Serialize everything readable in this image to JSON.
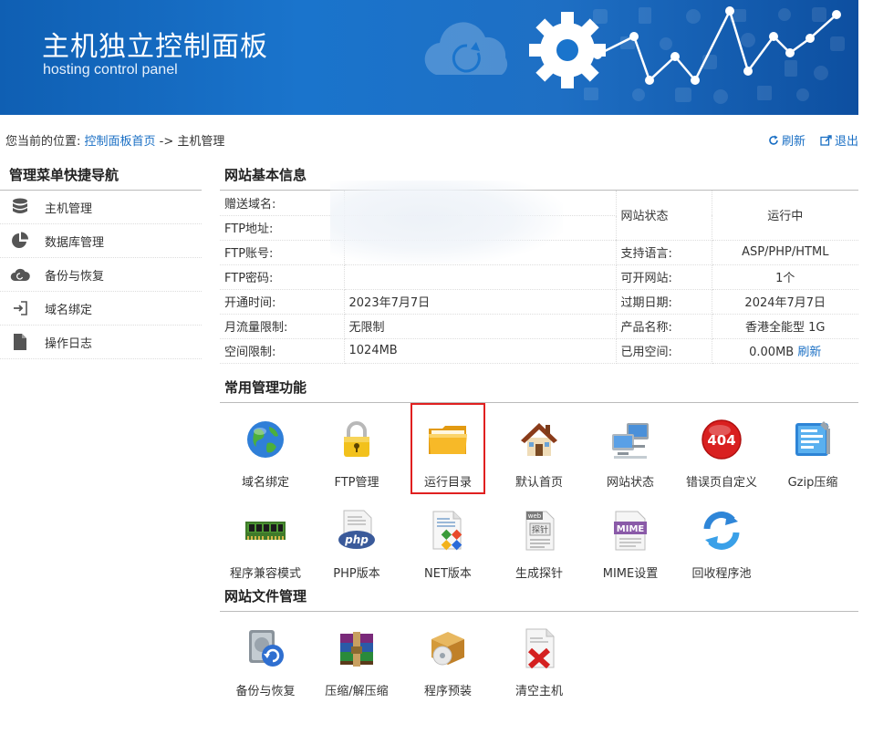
{
  "banner": {
    "title": "主机独立控制面板",
    "subtitle": "hosting control panel"
  },
  "location": {
    "prefix": "您当前的位置:",
    "home_link": "控制面板首页",
    "separator": " -> ",
    "current": "主机管理",
    "refresh_label": "刷新",
    "logout_label": "退出"
  },
  "sidebar": {
    "title": "管理菜单快捷导航",
    "items": [
      {
        "label": "主机管理",
        "icon": "database-icon"
      },
      {
        "label": "数据库管理",
        "icon": "pie-chart-icon"
      },
      {
        "label": "备份与恢复",
        "icon": "cloud-icon"
      },
      {
        "label": "域名绑定",
        "icon": "login-arrow-icon"
      },
      {
        "label": "操作日志",
        "icon": "document-icon"
      }
    ]
  },
  "site_info": {
    "title": "网站基本信息",
    "rows": [
      {
        "k": "赠送域名:",
        "v": "",
        "k2": "网站状态",
        "v2": "运行中"
      },
      {
        "k": "FTP地址:",
        "v": ""
      },
      {
        "k": "FTP账号:",
        "v": "",
        "k2": "支持语言:",
        "v2": "ASP/PHP/HTML"
      },
      {
        "k": "FTP密码:",
        "v": "",
        "k2": "可开网站:",
        "v2": "1个"
      },
      {
        "k": "开通时间:",
        "v": "2023年7月7日",
        "k2": "过期日期:",
        "v2": "2024年7月7日"
      },
      {
        "k": "月流量限制:",
        "v": "无限制",
        "k2": "产品名称:",
        "v2": "香港全能型 1G"
      },
      {
        "k": "空间限制:",
        "v": "1024MB",
        "k2": "已用空间:",
        "v2": "0.00MB",
        "v2_link": "刷新"
      }
    ],
    "status_color": "#2e9a2e"
  },
  "common": {
    "title": "常用管理功能",
    "tiles": [
      {
        "label": "域名绑定",
        "icon": "globe-icon"
      },
      {
        "label": "FTP管理",
        "icon": "padlock-icon"
      },
      {
        "label": "运行目录",
        "icon": "folder-icon",
        "highlighted": true
      },
      {
        "label": "默认首页",
        "icon": "house-icon"
      },
      {
        "label": "网站状态",
        "icon": "computers-icon"
      },
      {
        "label": "错误页自定义",
        "icon": "error-404-icon",
        "badge": "404"
      },
      {
        "label": "Gzip压缩",
        "icon": "archive-tool-icon"
      },
      {
        "label": "程序兼容模式",
        "icon": "memory-chip-icon"
      },
      {
        "label": "PHP版本",
        "icon": "php-icon",
        "badge": "php"
      },
      {
        "label": "NET版本",
        "icon": "net-document-icon"
      },
      {
        "label": "生成探针",
        "icon": "probe-document-icon",
        "badge": "web",
        "badge2": "探针"
      },
      {
        "label": "MIME设置",
        "icon": "mime-icon",
        "badge": "MIME"
      },
      {
        "label": "回收程序池",
        "icon": "recycle-arrows-icon"
      }
    ]
  },
  "files": {
    "title": "网站文件管理",
    "tiles": [
      {
        "label": "备份与恢复",
        "icon": "backup-disk-icon"
      },
      {
        "label": "压缩/解压缩",
        "icon": "rar-books-icon"
      },
      {
        "label": "程序预装",
        "icon": "package-cd-icon"
      },
      {
        "label": "清空主机",
        "icon": "delete-document-icon"
      }
    ]
  },
  "colors": {
    "banner": "#1a74cc",
    "link": "#1a6fc4",
    "highlight_border": "#e02020"
  }
}
